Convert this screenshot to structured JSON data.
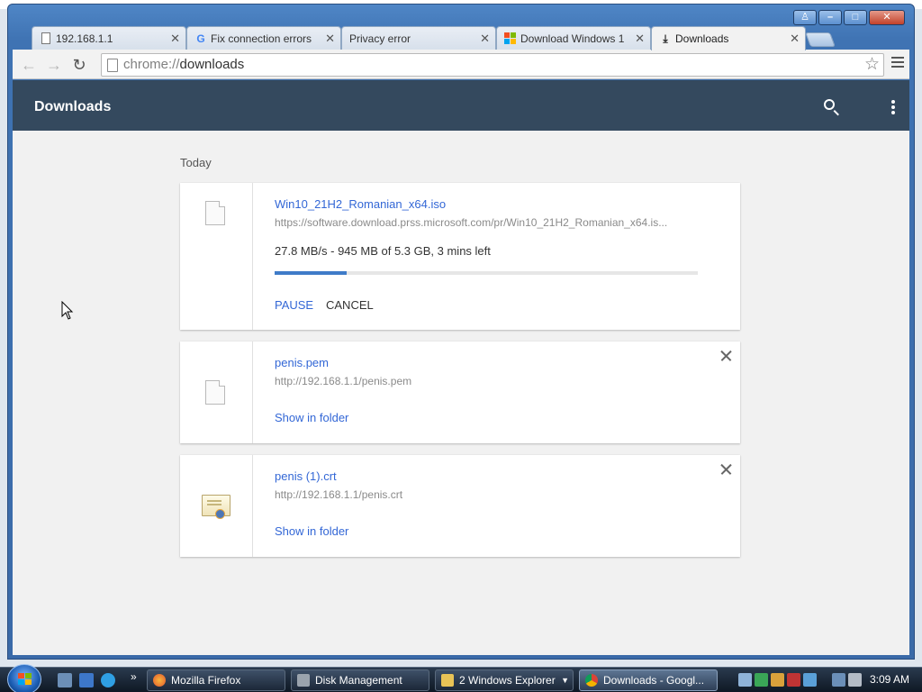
{
  "browser": {
    "window_controls": {
      "user": "♙",
      "minimize": "–",
      "maximize": "□",
      "close": "✕"
    },
    "tabs": [
      {
        "title": "192.168.1.1",
        "icon": "page-icon"
      },
      {
        "title": "Fix connection errors",
        "icon": "google-icon"
      },
      {
        "title": "Privacy error",
        "icon": "none"
      },
      {
        "title": "Download Windows 1",
        "icon": "windows-icon"
      },
      {
        "title": "Downloads",
        "icon": "download-icon"
      }
    ],
    "tab_close": "✕",
    "url_scheme": "chrome://",
    "url_path": "downloads"
  },
  "page": {
    "title": "Downloads",
    "section_label": "Today",
    "downloads": [
      {
        "name": "Win10_21H2_Romanian_x64.iso",
        "url": "https://software.download.prss.microsoft.com/pr/Win10_21H2_Romanian_x64.is...",
        "status": "27.8 MB/s - 945 MB of 5.3 GB, 3 mins left",
        "progress": 0.17,
        "pause_label": "PAUSE",
        "cancel_label": "CANCEL"
      },
      {
        "name": "penis.pem",
        "url": "http://192.168.1.1/penis.pem",
        "link": "Show in folder"
      },
      {
        "name": "penis (1).crt",
        "url": "http://192.168.1.1/penis.crt",
        "link": "Show in folder"
      }
    ]
  },
  "taskbar": {
    "items": [
      {
        "label": "Mozilla Firefox",
        "icon": "firefox-icon"
      },
      {
        "label": "Disk Management",
        "icon": "disk-management-icon"
      },
      {
        "label": "2 Windows Explorer",
        "icon": "folder-icon"
      },
      {
        "label": "Downloads - Googl...",
        "icon": "chrome-icon"
      }
    ],
    "quicklaunch_more": "»",
    "clock": "3:09 AM"
  },
  "colors": {
    "header_bg": "#34495e",
    "link_blue": "#3367d6",
    "progress_fill": "#3f7bc8"
  }
}
